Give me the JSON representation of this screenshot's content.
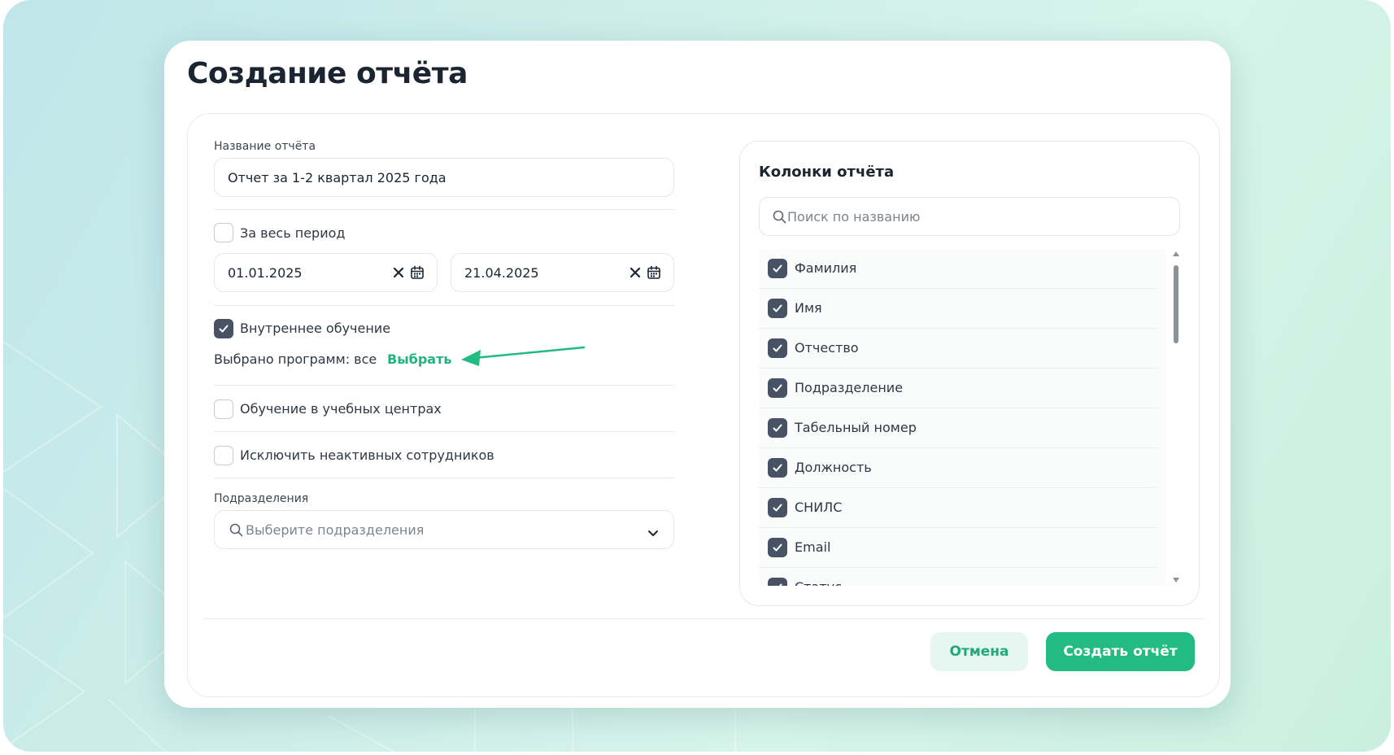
{
  "modal": {
    "title": "Создание отчёта"
  },
  "form": {
    "report_name_label": "Название отчёта",
    "report_name_value": "Отчет за 1-2 квартал 2025 года",
    "whole_period_label": "За весь период",
    "whole_period_checked": false,
    "date_from": "01.01.2025",
    "date_to": "21.04.2025",
    "internal_training_label": "Внутреннее обучение",
    "internal_training_checked": true,
    "programs_selected_text": "Выбрано программ: все",
    "programs_select_link": "Выбрать",
    "training_centers_label": "Обучение в учебных центрах",
    "training_centers_checked": false,
    "exclude_inactive_label": "Исключить неактивных сотрудников",
    "exclude_inactive_checked": false,
    "departments_label": "Подразделения",
    "departments_placeholder": "Выберите подразделения"
  },
  "columns_panel": {
    "title": "Колонки отчёта",
    "search_placeholder": "Поиск по названию",
    "items": [
      {
        "label": "Фамилия",
        "checked": true
      },
      {
        "label": "Имя",
        "checked": true
      },
      {
        "label": "Отчество",
        "checked": true
      },
      {
        "label": "Подразделение",
        "checked": true
      },
      {
        "label": "Табельный номер",
        "checked": true
      },
      {
        "label": "Должность",
        "checked": true
      },
      {
        "label": "СНИЛС",
        "checked": true
      },
      {
        "label": "Email",
        "checked": true
      },
      {
        "label": "Статус",
        "checked": true
      }
    ]
  },
  "footer": {
    "cancel_label": "Отмена",
    "create_label": "Создать отчёт"
  },
  "colors": {
    "accent": "#22bb84",
    "link": "#1fb47e",
    "checkbox_checked": "#475364"
  }
}
